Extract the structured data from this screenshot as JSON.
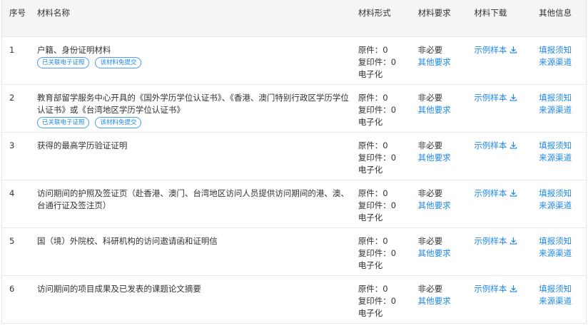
{
  "header": {
    "no": "序号",
    "name": "材料名称",
    "form": "材料形式",
    "requirement": "材料要求",
    "download": "材料下载",
    "other": "其他信息"
  },
  "rows": [
    {
      "no": "1",
      "name": "户籍、身份证明材料",
      "tags": [
        "已关联电子证照",
        "该材料免提交"
      ],
      "original": "原件：0",
      "copy": "复印件：0",
      "electronic": "电子化",
      "required": "非必要",
      "other_req": "其他要求",
      "sample": "示例样本",
      "fill_notice": "填报须知",
      "source": "来源渠道"
    },
    {
      "no": "2",
      "name": "教育部留学服务中心开具的《国外学历学位认证书》、《香港、澳门特别行政区学历学位认证书》或《台湾地区学历学位认证书》",
      "tags": [
        "已关联电子证照",
        "该材料免提交"
      ],
      "original": "原件：0",
      "copy": "复印件：0",
      "electronic": "电子化",
      "required": "非必要",
      "other_req": "其他要求",
      "sample": "示例样本",
      "fill_notice": "填报须知",
      "source": "来源渠道"
    },
    {
      "no": "3",
      "name": "获得的最高学历验证证明",
      "tags": [],
      "original": "原件：0",
      "copy": "复印件：0",
      "electronic": "电子化",
      "required": "非必要",
      "other_req": "其他要求",
      "sample": "示例样本",
      "fill_notice": "填报须知",
      "source": "来源渠道"
    },
    {
      "no": "4",
      "name": "访问期间的护照及签证页（赴香港、澳门、台湾地区访问人员提供访问期间的港、澳、台通行证及签注页）",
      "tags": [],
      "original": "原件：0",
      "copy": "复印件：0",
      "electronic": "电子化",
      "required": "非必要",
      "other_req": "其他要求",
      "sample": "示例样本",
      "fill_notice": "填报须知",
      "source": "来源渠道"
    },
    {
      "no": "5",
      "name": "国（境）外院校、科研机构的访问邀请函和证明信",
      "tags": [],
      "original": "原件：0",
      "copy": "复印件：0",
      "electronic": "电子化",
      "required": "非必要",
      "other_req": "其他要求",
      "sample": "示例样本",
      "fill_notice": "填报须知",
      "source": "来源渠道"
    },
    {
      "no": "6",
      "name": "访问期间的项目成果及已发表的课题论文摘要",
      "tags": [],
      "original": "原件：0",
      "copy": "复印件：0",
      "electronic": "电子化",
      "required": "非必要",
      "other_req": "其他要求",
      "sample": "示例样本",
      "fill_notice": "填报须知",
      "source": "来源渠道"
    }
  ],
  "colors": {
    "link": "#1e88e5",
    "header_bg": "#f5f5f5",
    "border": "#e8e8e8"
  }
}
